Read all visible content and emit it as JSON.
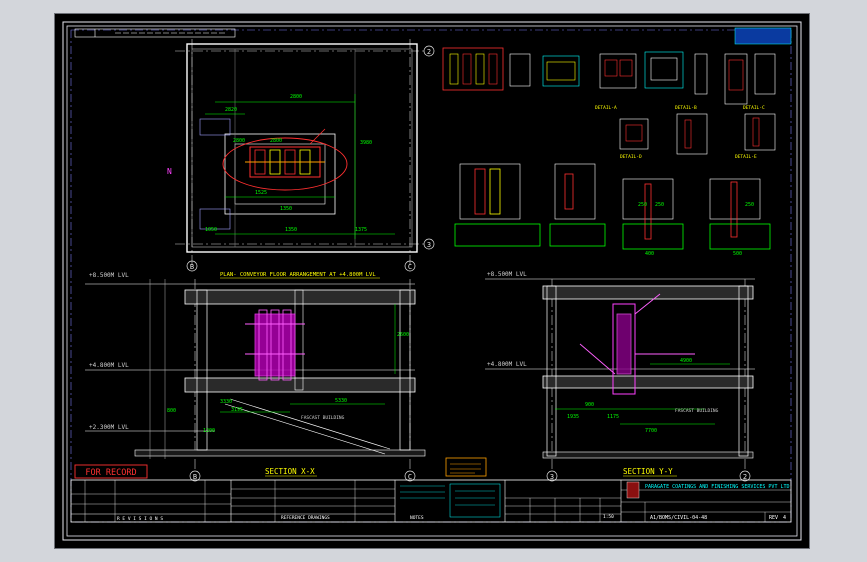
{
  "plan": {
    "grid_left": "B",
    "grid_right": "C",
    "grid_row_top": "2",
    "grid_row_bottom": "3",
    "north_mark": "N",
    "dims": [
      "2820",
      "2800",
      "2800",
      "2800",
      "1525",
      "3980",
      "1350",
      "1050",
      "1350",
      "1375",
      "1300",
      "2320",
      "2800"
    ],
    "title": "PLAN- CONVEYOR FLOOR ARRANGEMENT AT +4.800M LVL"
  },
  "section_x": {
    "level_top": "+8.500M LVL",
    "level_mid": "+4.800M LVL",
    "level_low": "+2.300M LVL",
    "dims": [
      "2600",
      "5330",
      "3195",
      "3330",
      "1200",
      "800"
    ],
    "grid_left": "B",
    "grid_right": "C",
    "conveyor_label": "FASCAST BUILDING",
    "title": "SECTION X-X"
  },
  "section_y": {
    "level_top": "+8.500M LVL",
    "level_mid": "+4.800M LVL",
    "dims": [
      "4900",
      "1935",
      "1175",
      "7700",
      "900"
    ],
    "grid_left": "3",
    "grid_right": "2",
    "conveyor_label": "FASCAST BUILDING",
    "title": "SECTION Y-Y"
  },
  "details": {
    "dims": [
      "250",
      "250",
      "250",
      "400",
      "500"
    ],
    "labels": [
      "DETAIL-A",
      "DETAIL-B",
      "DETAIL-C",
      "DETAIL-D",
      "DETAIL-E"
    ]
  },
  "stamp": "FOR RECORD",
  "legend_note": "NOTES",
  "title_block": {
    "company": "PARAGATE COATINGS AND FINISHING SERVICES PVT LTD",
    "drawing_no": "A1/BOMS/CIVIL-04-48",
    "rev_label": "REV",
    "rev_value": "0",
    "rev_value_short": "4",
    "scale": "1:50",
    "references_label": "REFERENCE DRAWINGS",
    "revisions_label": "R E V I S I O N S",
    "notes_label": "NOTES"
  }
}
